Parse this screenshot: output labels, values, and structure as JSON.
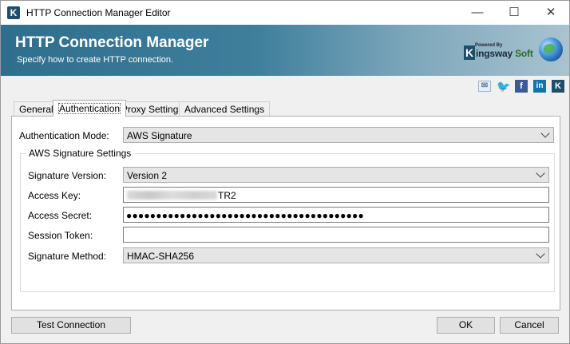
{
  "window": {
    "title": "HTTP Connection Manager Editor",
    "icon_glyph": "K",
    "min_glyph": "—",
    "max_glyph": "☐",
    "close_glyph": "✕"
  },
  "banner": {
    "title": "HTTP Connection Manager",
    "subtitle": "Specify how to create HTTP connection.",
    "logo_powered_by": "Powered By",
    "logo_k": "K",
    "logo_name_a": "ingsway",
    "logo_name_b": "Soft"
  },
  "social": {
    "mail": "✉",
    "twitter": "🐦",
    "facebook": "f",
    "linkedin": "in",
    "kingsway": "K"
  },
  "tabs": [
    {
      "label": "General"
    },
    {
      "label": "Authentication"
    },
    {
      "label": "Proxy Settings"
    },
    {
      "label": "Advanced Settings"
    }
  ],
  "auth": {
    "mode_label": "Authentication Mode:",
    "mode_value": "AWS Signature",
    "group_title": "AWS Signature Settings",
    "sig_version_label": "Signature Version:",
    "sig_version_value": "Version 2",
    "access_key_label": "Access Key:",
    "access_key_suffix": "TR2",
    "access_secret_label": "Access Secret:",
    "access_secret_value": "●●●●●●●●●●●●●●●●●●●●●●●●●●●●●●●●●●●●●●●●",
    "session_token_label": "Session Token:",
    "session_token_value": "",
    "sig_method_label": "Signature Method:",
    "sig_method_value": "HMAC-SHA256"
  },
  "footer": {
    "test": "Test Connection",
    "ok": "OK",
    "cancel": "Cancel"
  }
}
